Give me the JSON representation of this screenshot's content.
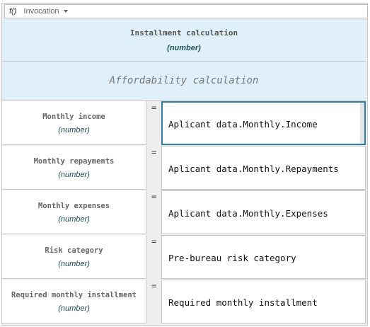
{
  "selector": {
    "fx": "f()",
    "kind": "Invocation"
  },
  "header": {
    "title": "Installment calculation",
    "type": "(number)"
  },
  "context": {
    "title": "Affordability calculation"
  },
  "rows": [
    {
      "name": "Monthly income",
      "type": "(number)",
      "expression": "Aplicant data.Monthly.Income",
      "eq": "="
    },
    {
      "name": "Monthly repayments",
      "type": "(number)",
      "expression": "Aplicant data.Monthly.Repayments",
      "eq": "="
    },
    {
      "name": "Monthly expenses",
      "type": "(number)",
      "expression": "Aplicant data.Monthly.Expenses",
      "eq": "="
    },
    {
      "name": "Risk category",
      "type": "(number)",
      "expression": "Pre-bureau risk category",
      "eq": "="
    },
    {
      "name": "Required monthly installment",
      "type": "(number)",
      "expression": "Required monthly installment",
      "eq": "="
    }
  ],
  "colors": {
    "header_bg": "#dff0fb",
    "active_border": "#2f7ea5",
    "type_text": "#1f4f59"
  }
}
